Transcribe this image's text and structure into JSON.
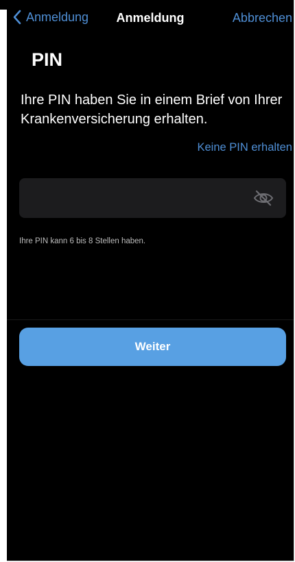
{
  "navigation": {
    "back_label": "Anmeldung",
    "title": "Anmeldung",
    "cancel_label": "Abbrechen"
  },
  "content": {
    "heading": "PIN",
    "description": "Ihre PIN haben Sie in einem Brief von Ihrer Krankenversicherung erhalten.",
    "no_pin_link": "Keine PIN erhalten",
    "pin_value": "",
    "hint": "Ihre PIN kann 6 bis 8 Stellen haben."
  },
  "actions": {
    "continue_label": "Weiter"
  },
  "icons": {
    "back": "chevron-left-icon",
    "visibility": "eye-slash-icon"
  },
  "colors": {
    "background": "#000000",
    "accent": "#4f8fd6",
    "button": "#58a0e3",
    "field": "#1c1c1e"
  }
}
